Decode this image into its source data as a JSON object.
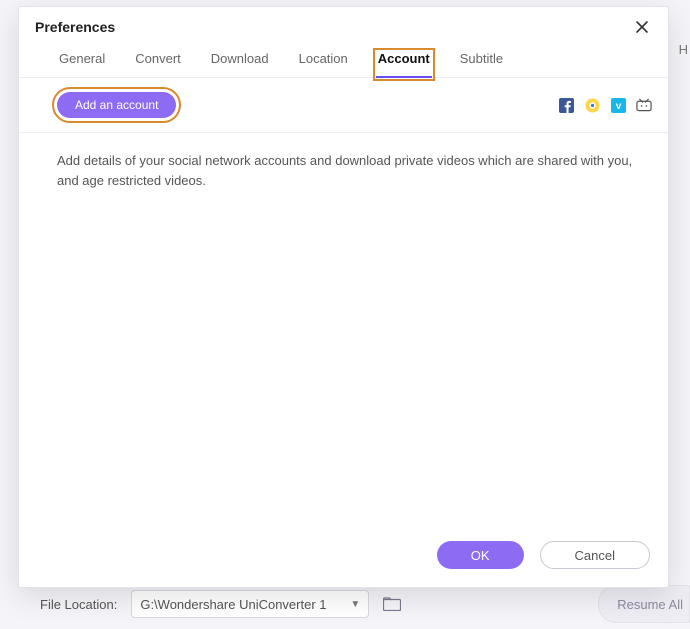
{
  "dialog": {
    "title": "Preferences",
    "tabs": [
      "General",
      "Convert",
      "Download",
      "Location",
      "Account",
      "Subtitle"
    ],
    "active_tab_index": 4,
    "add_account_label": "Add an account",
    "description": "Add details of your social network accounts and download private videos which are shared with you, and age restricted videos.",
    "ok_label": "OK",
    "cancel_label": "Cancel"
  },
  "social_icons": [
    "facebook",
    "browser-globe",
    "vimeo",
    "bilibili"
  ],
  "background": {
    "file_location_label": "File Location:",
    "file_location_value": "G:\\Wondershare UniConverter 1",
    "resume_label": "Resume All",
    "stray_letter": "H"
  }
}
